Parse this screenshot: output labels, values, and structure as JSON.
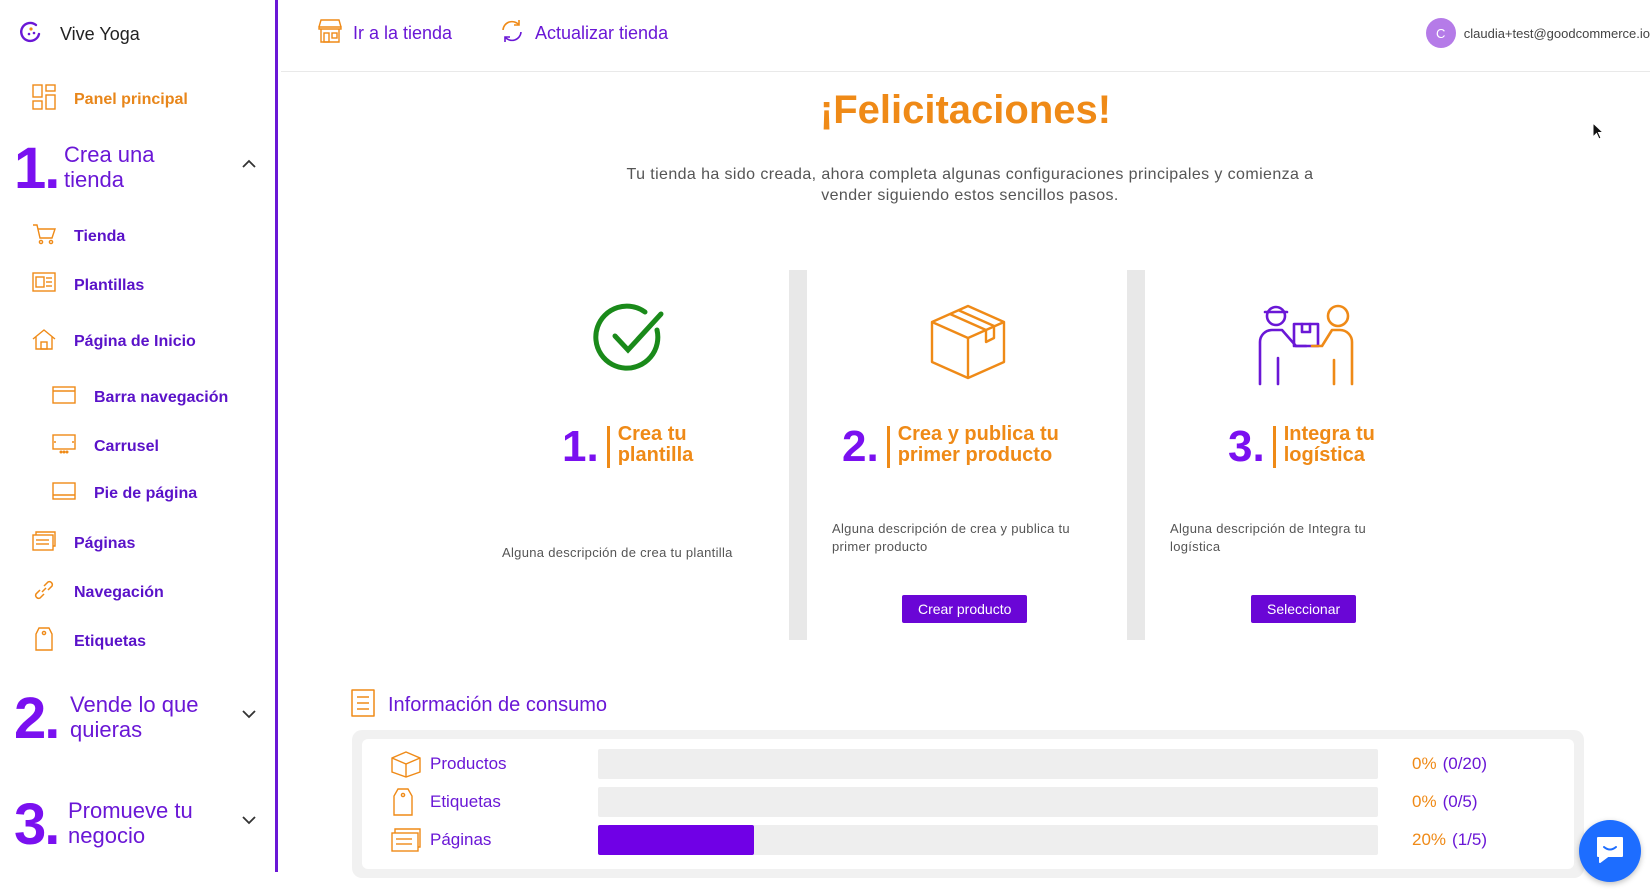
{
  "app": {
    "store_name": "Vive Yoga"
  },
  "topbar": {
    "go_store": "Ir a la tienda",
    "update_store": "Actualizar tienda",
    "user_initial": "C",
    "user_email": "claudia+test@goodcommerce.io"
  },
  "sidebar": {
    "dashboard": "Panel principal",
    "section1": {
      "num": "1.",
      "title": "Crea una tienda"
    },
    "items": {
      "tienda": "Tienda",
      "plantillas": "Plantillas",
      "inicio": "Página de Inicio",
      "barra": "Barra navegación",
      "carrusel": "Carrusel",
      "pie": "Pie de página",
      "paginas": "Páginas",
      "navegacion": "Navegación",
      "etiquetas": "Etiquetas"
    },
    "section2": {
      "num": "2.",
      "title": "Vende lo que quieras"
    },
    "section3": {
      "num": "3.",
      "title": "Promueve tu negocio"
    }
  },
  "main": {
    "headline": "¡Felicitaciones!",
    "subline": "Tu tienda ha sido creada, ahora completa algunas configuraciones principales y comienza a vender siguiendo estos sencillos pasos.",
    "steps": [
      {
        "num": "1.",
        "title": "Crea tu plantilla",
        "desc": "Alguna descripción de crea tu plantilla",
        "button": ""
      },
      {
        "num": "2.",
        "title": "Crea y publica tu primer producto",
        "desc": "Alguna descripción de crea y publica tu primer producto",
        "button": "Crear producto"
      },
      {
        "num": "3.",
        "title": "Integra tu logística",
        "desc": "Alguna descripción de Integra tu logística",
        "button": "Seleccionar"
      }
    ],
    "usage": {
      "title": "Información de consumo",
      "rows": [
        {
          "name": "Productos",
          "pct": "0%",
          "count": "(0/20)",
          "fill": 0
        },
        {
          "name": "Etiquetas",
          "pct": "0%",
          "count": "(0/5)",
          "fill": 0
        },
        {
          "name": "Páginas",
          "pct": "20%",
          "count": "(1/5)",
          "fill": 0.2
        }
      ]
    }
  },
  "colors": {
    "primary": "#6a17d6",
    "accent": "#ef8a17",
    "success": "#1a8a1a",
    "chat": "#1d6dff"
  }
}
